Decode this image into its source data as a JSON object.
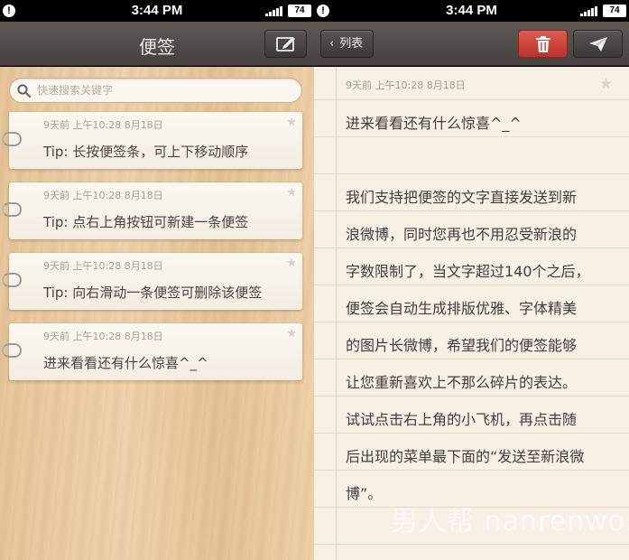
{
  "status_bar": {
    "time": "3:44 PM",
    "battery": "74",
    "alert": "!"
  },
  "list_screen": {
    "title": "便签",
    "search_placeholder": "快速搜索关键字",
    "notes": [
      {
        "meta": "9天前  上午10:28  8月18日",
        "text": "Tip: 长按便签条，可上下移动顺序"
      },
      {
        "meta": "9天前  上午10:28  8月18日",
        "text": "Tip: 点右上角按钮可新建一条便签"
      },
      {
        "meta": "9天前  上午10:28  8月18日",
        "text": "Tip: 向右滑动一条便签可删除该便签"
      },
      {
        "meta": "9天前  上午10:28  8月18日",
        "text": "进来看看还有什么惊喜^_^"
      }
    ]
  },
  "detail_screen": {
    "back_label": "列表",
    "meta": "9天前  上午10:28  8月18日",
    "title_line": "进来看看还有什么惊喜^_^",
    "body_lines": [
      "我们支持把便签的文字直接发送到新",
      "浪微博，同时您再也不用忍受新浪的",
      "字数限制了，当文字超过140个之后，",
      "便签会自动生成排版优雅、字体精美",
      "的图片长微博，希望我们的便签能够",
      "让您重新喜欢上不那么碎片的表达。",
      "试试点击右上角的小飞机，再点击随",
      "后出现的菜单最下面的“发送至新浪微",
      "博”。"
    ],
    "watermark": "男人帮 nanrenwo.net"
  },
  "icons": {
    "compose": "compose-icon",
    "trash": "trash-icon",
    "send": "paper-plane-icon",
    "star": "star-icon",
    "clip": "paperclip-icon"
  },
  "colors": {
    "nav": "#4f4a47",
    "delete": "#c9403a",
    "wood": "#ebcba1",
    "paper": "#f6f0e5"
  }
}
